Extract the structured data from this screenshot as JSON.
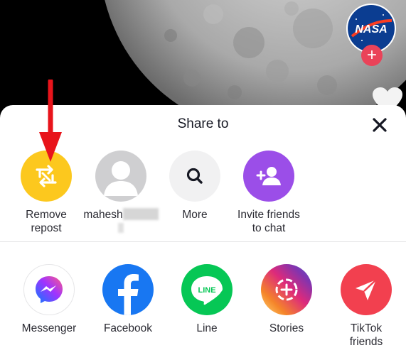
{
  "video": {
    "creator_avatar_text": "NASA",
    "follow_icon": "plus-icon"
  },
  "share_sheet": {
    "title": "Share to",
    "close_icon": "close-icon",
    "row1": [
      {
        "label": "Remove repost",
        "line1": "Remove",
        "line2": "repost",
        "icon": "repost-icon",
        "color": "#fcc81e"
      },
      {
        "label": "mahesh",
        "line1": "mahesh",
        "line2": "",
        "icon": "user-avatar-icon",
        "color": "#cfcfd1"
      },
      {
        "label": "More",
        "line1": "More",
        "line2": "",
        "icon": "search-icon",
        "color": "#f1f1f2"
      },
      {
        "label": "Invite friends to chat",
        "line1": "Invite friends",
        "line2": "to chat",
        "icon": "add-user-icon",
        "color": "#9b4ee8"
      }
    ],
    "row2": [
      {
        "label": "Messenger",
        "line1": "Messenger",
        "line2": "",
        "icon": "messenger-icon",
        "color": "#ffffff"
      },
      {
        "label": "Facebook",
        "line1": "Facebook",
        "line2": "",
        "icon": "facebook-icon",
        "color": "#1877f2"
      },
      {
        "label": "Line",
        "line1": "Line",
        "line2": "",
        "icon": "line-icon",
        "color": "#06c755"
      },
      {
        "label": "Stories",
        "line1": "Stories",
        "line2": "",
        "icon": "stories-icon",
        "color": "#e9418a"
      },
      {
        "label": "TikTok friends",
        "line1": "TikTok",
        "line2": "friends",
        "icon": "send-icon",
        "color": "#f2404f"
      }
    ]
  }
}
